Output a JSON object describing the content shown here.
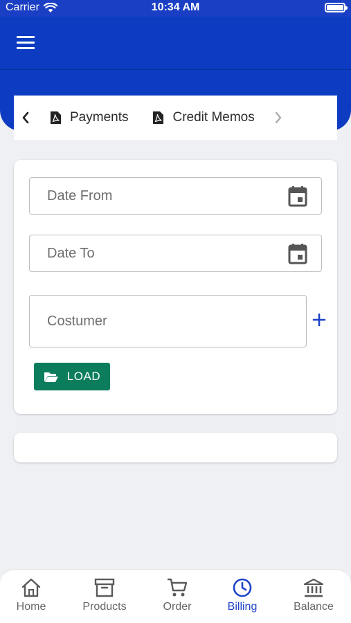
{
  "status_bar": {
    "carrier": "Carrier",
    "time": "10:34 AM",
    "battery_level": 1.0
  },
  "app_bar": {
    "menu_icon": "hamburger-menu-icon"
  },
  "tabs": {
    "prev_icon": "chevron-left-icon",
    "next_icon": "chevron-right-icon",
    "items": [
      {
        "label": "Payments",
        "icon": "pdf-file-icon"
      },
      {
        "label": "Credit Memos",
        "icon": "pdf-file-icon"
      }
    ]
  },
  "form": {
    "date_from": {
      "placeholder": "Date From",
      "value": ""
    },
    "date_to": {
      "placeholder": "Date To",
      "value": ""
    },
    "customer": {
      "placeholder": "Costumer",
      "value": ""
    },
    "load_button": {
      "label": "LOAD",
      "icon": "folder-open-icon"
    }
  },
  "bottom_nav": {
    "items": [
      {
        "label": "Home",
        "icon": "home-icon",
        "active": false
      },
      {
        "label": "Products",
        "icon": "archive-box-icon",
        "active": false
      },
      {
        "label": "Order",
        "icon": "cart-icon",
        "active": false
      },
      {
        "label": "Billing",
        "icon": "clock-icon",
        "active": true
      },
      {
        "label": "Balance",
        "icon": "bank-icon",
        "active": false
      }
    ]
  },
  "colors": {
    "primary": "#0d3cc2",
    "accent_green": "#0b7d5c",
    "active_tab": "#1c43c9",
    "background": "#eff0f4"
  }
}
